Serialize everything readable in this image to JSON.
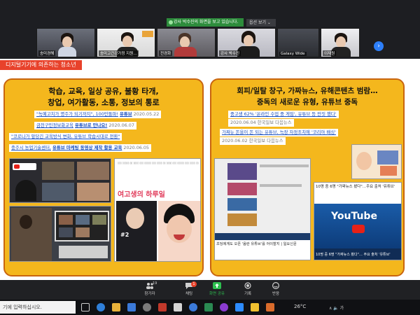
{
  "banner": {
    "share_text": "강사 박수진의 화면을 보고 있습니다.",
    "view_option": "옵션 보기 ⌄"
  },
  "participants": [
    {
      "label": "송미경해"
    },
    {
      "label": "송미고건강가정 지원…"
    },
    {
      "label": "전경화"
    },
    {
      "label": "강사 박수진"
    },
    {
      "label": "Galaxy Wide"
    },
    {
      "label": "이재원"
    }
  ],
  "slide": {
    "title": "디지털기기에 의존하는 청소년",
    "left": {
      "heading_line1": "학습, 교육, 일상 공유, 불황 타개,",
      "heading_line2": "창업, 여가활동, 소통, 정보의 통로",
      "news": [
        {
          "text": "\"녹예고치가 명주가 되기까지\", 100만돌파!",
          "tag": "유튜브",
          "date": "2020.05.22"
        },
        {
          "text": "금천구민정보화교육",
          "tag": "유튜브로 만나요!",
          "date": "2020.06.07"
        },
        {
          "text": "\"코로나가 앞당긴 교육방식 변화, 유튜브 학습시대로 전환\"",
          "tag": "",
          "date": ""
        },
        {
          "text": "충주시 농업기술센터,",
          "tag": "유튜브 마케팅 동영상 제작 활용 교육",
          "date": "2020.06.05"
        }
      ],
      "img_caption": "여고생의 하루일"
    },
    "right": {
      "heading_line1": "회피/일탈 창구, 가짜뉴스, 유해콘텐츠 범람…",
      "heading_line2": "중독의 새로운 유형, 유튜브 중독",
      "news": [
        {
          "text": "중고생 62% '온라인 수업 중 게임', 유튜브 등 딴짓 했다'",
          "source": "2020.06.04  한국일보  다음뉴스"
        },
        {
          "text": "가짜뉴 돈을이 돈 되는 유튜브, 늑장 자정조치에 '코리아 배싱'",
          "source": "2020.06.02  한국일보  다음뉴스"
        }
      ],
      "caption1": "10명 중 6명 \"가짜뉴스 봤다\"…주요 출처 '유튜브'",
      "youtube_logo": "YouTube",
      "caption2": "초딩에게도 오픈 '음란 유튜브'를 어이할지 | 일요신문",
      "bottom_strip": "10명 중 6명 \"가짜뉴스 봤다\"… 주요 출처 '유튜브'"
    }
  },
  "toolbar": {
    "participants_count": "19",
    "participants": "참가자",
    "chat": "채팅",
    "chat_badge": "1",
    "share": "화면 공유",
    "record": "기록",
    "reactions": "반응"
  },
  "taskbar": {
    "search_placeholder": "기에 입력하십시오.",
    "temp": "26°C",
    "tray": "∧ 🔈 가"
  }
}
